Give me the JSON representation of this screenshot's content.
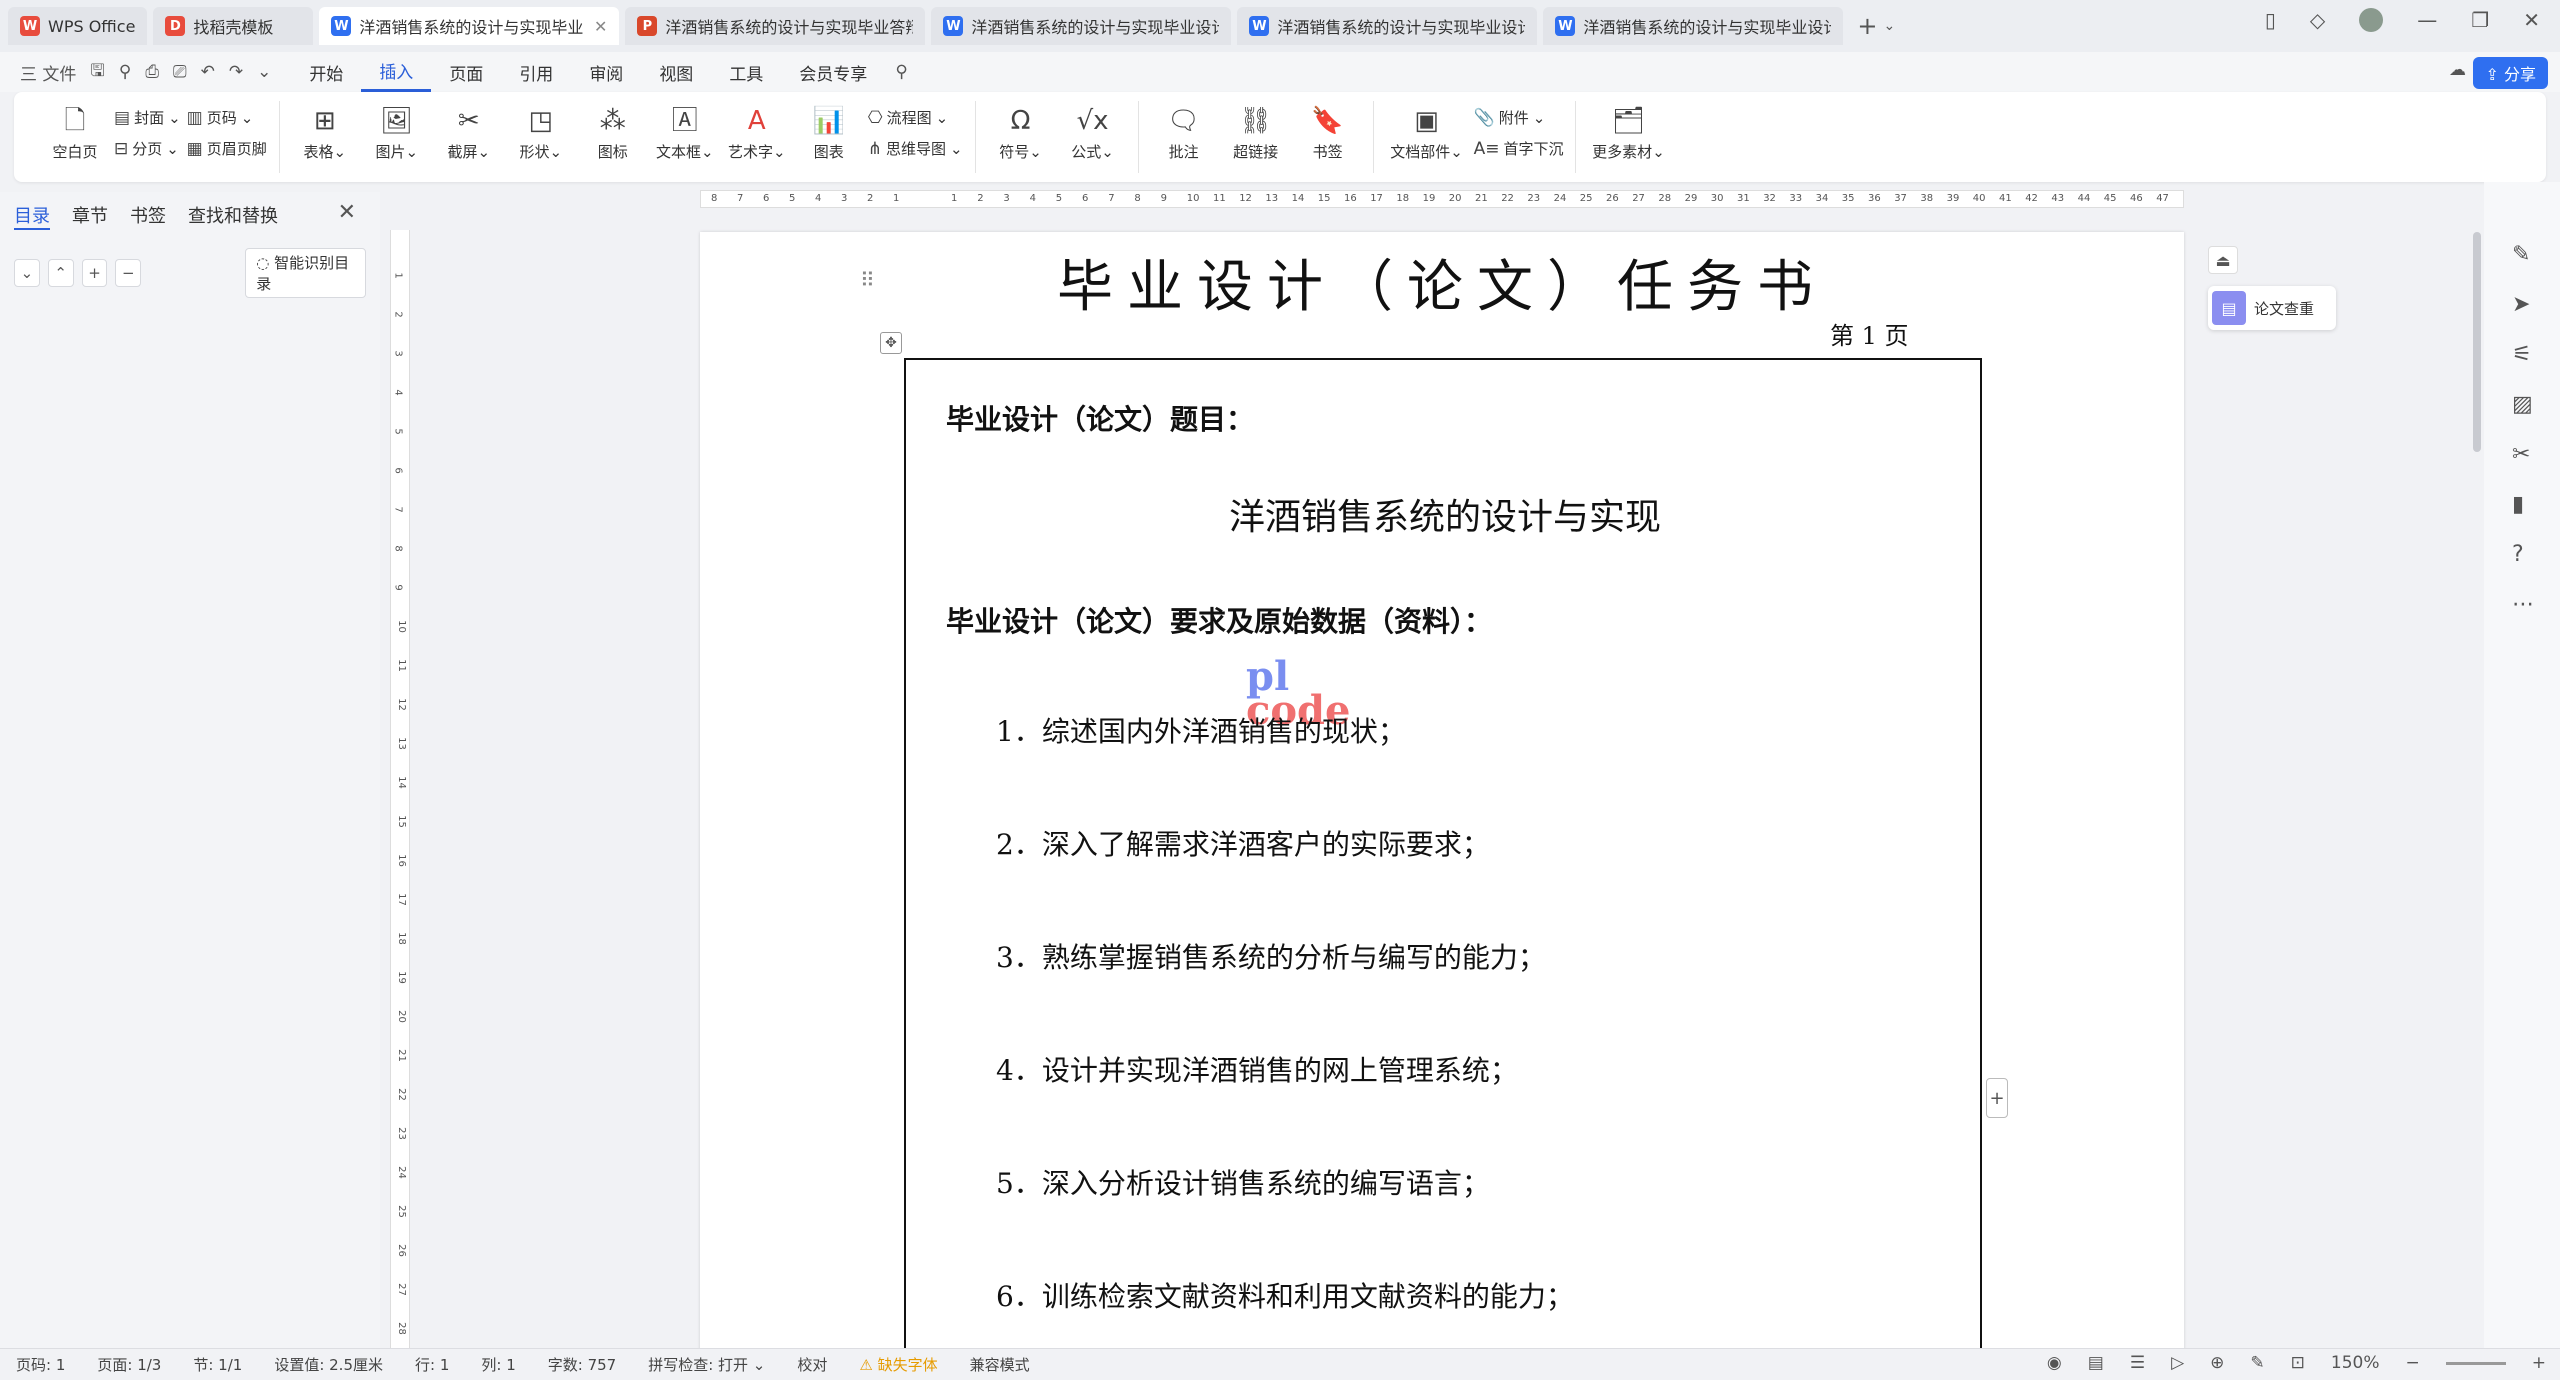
{
  "tabs": [
    {
      "label": "WPS Office",
      "icon": "W",
      "color": "#e84c3d"
    },
    {
      "label": "找稻壳模板",
      "icon": "D",
      "color": "#e84c3d"
    },
    {
      "label": "洋酒销售系统的设计与实现毕业设任",
      "icon": "W",
      "color": "#2f6ff0",
      "active": true
    },
    {
      "label": "洋酒销售系统的设计与实现毕业答辩p",
      "icon": "P",
      "color": "#d9482b"
    },
    {
      "label": "洋酒销售系统的设计与实现毕业设计论",
      "icon": "W",
      "color": "#2f6ff0"
    },
    {
      "label": "洋酒销售系统的设计与实现毕业设计-",
      "icon": "W",
      "color": "#2f6ff0"
    },
    {
      "label": "洋酒销售系统的设计与实现毕业设计",
      "icon": "W",
      "color": "#2f6ff0"
    }
  ],
  "menu": {
    "file": "三 文件",
    "items": [
      "开始",
      "插入",
      "页面",
      "引用",
      "审阅",
      "视图",
      "工具",
      "会员专享"
    ],
    "active": "插入",
    "share": "分享"
  },
  "ribbon": {
    "g1": {
      "big": "空白页",
      "s1": "封面",
      "s2": "分页",
      "s3": "页码",
      "s4": "页眉页脚"
    },
    "g2": [
      "表格",
      "图片",
      "截屏",
      "形状",
      "图标",
      "文本框",
      "艺术字",
      "图表"
    ],
    "g2s": {
      "flow": "流程图",
      "mind": "思维导图"
    },
    "g3": [
      "符号",
      "公式"
    ],
    "g4": [
      "批注",
      "超链接",
      "书签"
    ],
    "g5": {
      "big": "文档部件",
      "s1": "附件",
      "s2": "首字下沉"
    },
    "g6": "更多素材"
  },
  "leftpanel": {
    "tabs": [
      "目录",
      "章节",
      "书签",
      "查找和替换"
    ],
    "active": "目录",
    "smart": "智能识别目录"
  },
  "document": {
    "title": "毕业设计（论文）任务书",
    "page_no": "第 1 页",
    "label_subject": "毕业设计（论文）题目：",
    "subject": "洋酒销售系统的设计与实现",
    "label_req": "毕业设计（论文）要求及原始数据（资料）：",
    "reqs": [
      "1．综述国内外洋酒销售的现状；",
      "2．深入了解需求洋酒客户的实际要求；",
      "3．熟练掌握销售系统的分析与编写的能力；",
      "4．设计并实现洋酒销售的网上管理系统；",
      "5．深入分析设计销售系统的编写语言；",
      "6．训练检索文献资料和利用文献资料的能力；"
    ],
    "watermark_a": "pl",
    "watermark_b": "code"
  },
  "side": {
    "check": "论文查重"
  },
  "status": {
    "page": "页码: 1",
    "pages": "页面: 1/3",
    "section": "节: 1/1",
    "setting": "设置值: 2.5厘米",
    "row": "行: 1",
    "col": "列: 1",
    "words": "字数: 757",
    "spell": "拼写检查: 打开 ⌄",
    "proof": "校对",
    "font": "⚠ 缺失字体",
    "compat": "兼容模式",
    "zoom": "150%"
  }
}
